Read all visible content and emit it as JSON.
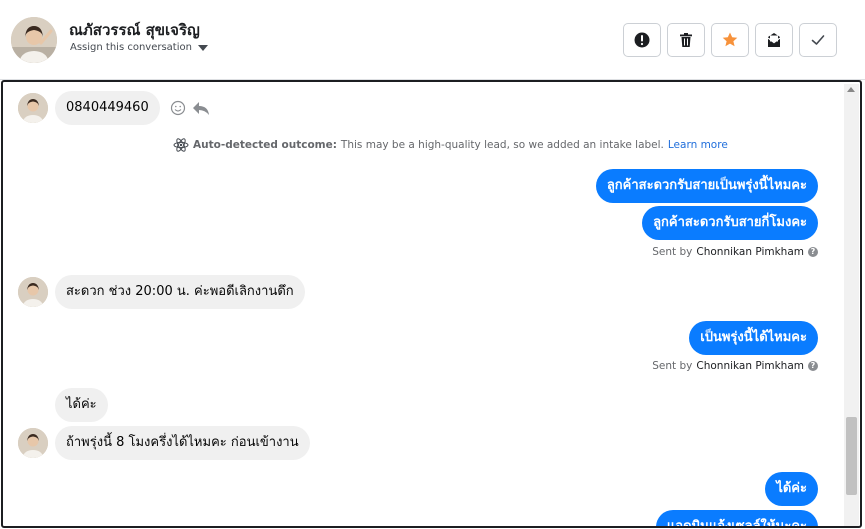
{
  "header": {
    "contact_name": "ณภัสวรรณ์ สุขเจริญ",
    "assign_label": "Assign this conversation",
    "actions": [
      {
        "name": "mark-spam-button",
        "icon": "alert-circle-icon"
      },
      {
        "name": "delete-button",
        "icon": "trash-icon"
      },
      {
        "name": "star-button",
        "icon": "star-icon"
      },
      {
        "name": "mark-unread-button",
        "icon": "mail-icon"
      },
      {
        "name": "mark-done-button",
        "icon": "check-icon"
      }
    ]
  },
  "colors": {
    "accent": "#0a7cff",
    "star": "#f7923b",
    "link": "#216fdb",
    "incoming_bubble": "#f0f0f0"
  },
  "thread": {
    "messages": [
      {
        "dir": "in",
        "text": "0840449460"
      },
      {
        "dir": "out",
        "text": "ลูกค้าสะดวกรับสายเป็นพรุ่งนี้ไหมคะ"
      },
      {
        "dir": "out",
        "text": "ลูกค้าสะดวกรับสายกี่โมงคะ"
      },
      {
        "dir": "in",
        "text": "สะดวก ช่วง 20:00 น. ค่ะพอดีเลิกงานดึก"
      },
      {
        "dir": "out",
        "text": "เป็นพรุ่งนี้ได้ไหมคะ"
      },
      {
        "dir": "in",
        "text": "ได้ค่ะ"
      },
      {
        "dir": "in",
        "text": "ถ้าพรุ่งนี้ 8 โมงครึ่งได้ไหมคะ ก่อนเข้างาน"
      },
      {
        "dir": "out",
        "text": "ได้ค่ะ"
      },
      {
        "dir": "out",
        "text": "แอดมินแจ้งเซลล์ให้นะคะ"
      }
    ],
    "auto_detect": {
      "label": "Auto-detected outcome:",
      "text": "This may be a high-quality lead, so we added an intake label.",
      "link": "Learn more"
    },
    "sent_by_prefix": "Sent by",
    "sent_by_name": "Chonnikan Pimkham"
  }
}
